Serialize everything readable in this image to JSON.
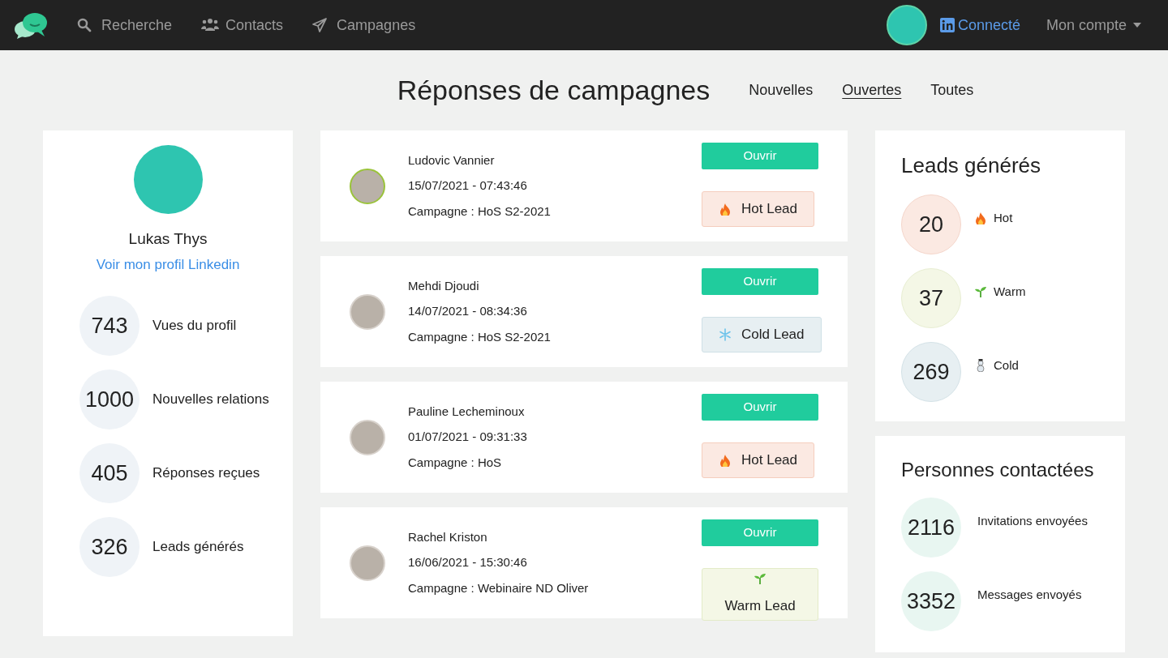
{
  "navbar": {
    "links": [
      {
        "kind": "search",
        "label": "Recherche"
      },
      {
        "kind": "users",
        "label": "Contacts"
      },
      {
        "kind": "send",
        "label": "Campagnes"
      }
    ],
    "linkedin": "Connecté",
    "account": "Mon compte"
  },
  "header": {
    "title": "Réponses de campagnes",
    "tabs": [
      {
        "label": "Nouvelles",
        "selected": false
      },
      {
        "label": "Ouvertes",
        "selected": true
      },
      {
        "label": "Toutes",
        "selected": false
      }
    ]
  },
  "profile": {
    "name": "Lukas Thys",
    "link": "Voir mon profil Linkedin",
    "stats": [
      {
        "value": "743",
        "label": "Vues du profil"
      },
      {
        "value": "1000",
        "label": "Nouvelles relations"
      },
      {
        "value": "405",
        "label": "Réponses reçues"
      },
      {
        "value": "326",
        "label": "Leads générés"
      }
    ]
  },
  "responses": [
    {
      "name": "Ludovic Vannier",
      "date": "15/07/2021 - 07:43:46",
      "campaign": "Campagne : HoS S2-2021",
      "button": "Ouvrir",
      "lead": {
        "kind": "hot",
        "label": "Hot Lead"
      }
    },
    {
      "name": "Mehdi Djoudi",
      "date": "14/07/2021 - 08:34:36",
      "campaign": "Campagne : HoS S2-2021",
      "button": "Ouvrir",
      "lead": {
        "kind": "cold",
        "label": "Cold Lead"
      }
    },
    {
      "name": "Pauline Lecheminoux",
      "date": "01/07/2021 - 09:31:33",
      "campaign": "Campagne : HoS",
      "button": "Ouvrir",
      "lead": {
        "kind": "hot",
        "label": "Hot Lead"
      }
    },
    {
      "name": "Rachel Kriston",
      "date": "16/06/2021 - 15:30:46",
      "campaign": "Campagne : Webinaire ND Oliver",
      "button": "Ouvrir",
      "lead": {
        "kind": "warm",
        "label": "Warm Lead"
      }
    }
  ],
  "leads": {
    "title": "Leads générés",
    "items": [
      {
        "kind": "hot",
        "value": "20",
        "label": "Hot"
      },
      {
        "kind": "warm",
        "value": "37",
        "label": "Warm"
      },
      {
        "kind": "cold",
        "value": "269",
        "label": "Cold"
      }
    ]
  },
  "contacted": {
    "title": "Personnes contactées",
    "items": [
      {
        "value": "2116",
        "label": "Invitations envoyées"
      },
      {
        "value": "3352",
        "label": "Messages envoyés"
      }
    ]
  }
}
